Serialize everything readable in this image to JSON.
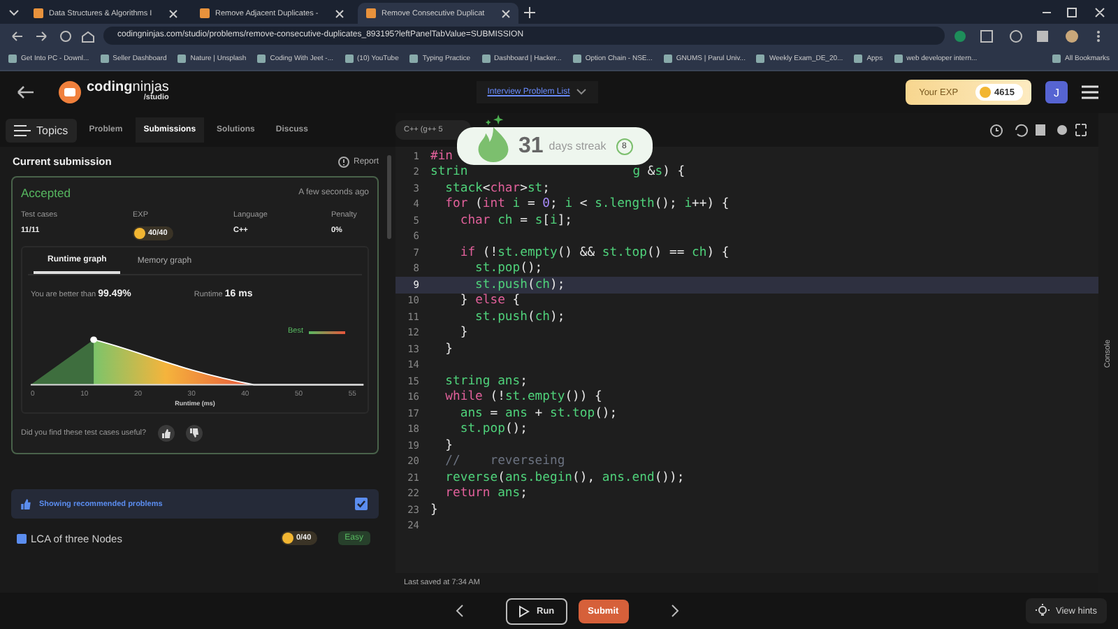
{
  "browser": {
    "tabs": [
      {
        "title": "Data Structures & Algorithms I",
        "selected": false
      },
      {
        "title": "Remove Adjacent Duplicates -",
        "selected": false
      },
      {
        "title": "Remove Consecutive Duplicat",
        "selected": true
      }
    ],
    "url": "codingninjas.com/studio/problems/remove-consecutive-duplicates_893195?leftPanelTabValue=SUBMISSION",
    "bookmarks": [
      "Get Into PC - Downl...",
      "Seller Dashboard",
      "Nature | Unsplash",
      "Coding With Jeet -...",
      "(10) YouTube",
      "Typing Practice",
      "Dashboard | Hacker...",
      "Option Chain - NSE...",
      "GNUMS | Parul Univ...",
      "Weekly Exam_DE_20...",
      "Apps",
      "web developer intern..."
    ],
    "all_bookmarks": "All Bookmarks"
  },
  "header": {
    "logo_word_1": "coding",
    "logo_word_2": "ninjas",
    "logo_sub": "/studio",
    "center_link": "Interview Problem List",
    "exp_label": "Your EXP",
    "exp_value": "4615",
    "avatar": "J"
  },
  "left": {
    "topics": "Topics",
    "tabs": [
      {
        "label": "Problem",
        "selected": false
      },
      {
        "label": "Submissions",
        "selected": true
      },
      {
        "label": "Solutions",
        "selected": false
      },
      {
        "label": "Discuss",
        "selected": false
      }
    ],
    "title": "Current submission",
    "report": "Report",
    "status": "Accepted",
    "time": "A few seconds ago",
    "stats": [
      {
        "label": "Test cases",
        "value": "11/11",
        "kind": "text"
      },
      {
        "label": "EXP",
        "value": "40/40",
        "kind": "coin"
      },
      {
        "label": "Language",
        "value": "C++",
        "kind": "text"
      },
      {
        "label": "Penalty",
        "value": "0%",
        "kind": "text"
      }
    ],
    "graph_tabs": [
      {
        "label": "Runtime graph",
        "selected": true
      },
      {
        "label": "Memory graph",
        "selected": false
      }
    ],
    "better_label": "You are better than",
    "better_value": "99.49%",
    "runtime_label": "Runtime",
    "runtime_value": "16 ms",
    "legend": "Best",
    "x_ticks": [
      "0",
      "10",
      "20",
      "30",
      "40",
      "50",
      "55"
    ],
    "x_label": "Runtime (ms)",
    "feedback": "Did you find these test cases useful?",
    "recommended": {
      "label": "Showing recommended problems",
      "checked": true
    },
    "problems": [
      {
        "title": "LCA of three Nodes",
        "exp": "0/40",
        "difficulty": "Easy"
      }
    ]
  },
  "editor": {
    "language": "C++ (g++ 5",
    "streak": {
      "count": "31",
      "label": "days streak",
      "badge": "8"
    },
    "lines": [
      {
        "n": "1",
        "current": false,
        "tokens": [
          {
            "t": "#in",
            "kind": "keyword"
          }
        ]
      },
      {
        "n": "2",
        "current": false,
        "tokens": [
          {
            "t": "strin",
            "kind": "name"
          }
        ],
        "tokens_after_popup": [
          {
            "t": "g",
            "kind": "name"
          },
          {
            "t": " &",
            "kind": "punct"
          },
          {
            "t": "s",
            "kind": "name"
          },
          {
            "t": ") {",
            "kind": "punct"
          }
        ]
      },
      {
        "n": "3",
        "current": false,
        "tokens": [
          {
            "t": "  stack",
            "kind": "name"
          },
          {
            "t": "<",
            "kind": "punct"
          },
          {
            "t": "char",
            "kind": "keyword"
          },
          {
            "t": ">",
            "kind": "punct"
          },
          {
            "t": "st",
            "kind": "name"
          },
          {
            "t": ";",
            "kind": "punct"
          }
        ]
      },
      {
        "n": "4",
        "current": false,
        "tokens": [
          {
            "t": "  for",
            "kind": "keyword"
          },
          {
            "t": " (",
            "kind": "punct"
          },
          {
            "t": "int",
            "kind": "keyword"
          },
          {
            "t": " i",
            "kind": "name"
          },
          {
            "t": " = ",
            "kind": "punct"
          },
          {
            "t": "0",
            "kind": "number"
          },
          {
            "t": "; ",
            "kind": "punct"
          },
          {
            "t": "i",
            "kind": "name"
          },
          {
            "t": " < ",
            "kind": "punct"
          },
          {
            "t": "s.length",
            "kind": "name"
          },
          {
            "t": "(); ",
            "kind": "punct"
          },
          {
            "t": "i",
            "kind": "name"
          },
          {
            "t": "++) {",
            "kind": "punct"
          }
        ]
      },
      {
        "n": "5",
        "current": false,
        "tokens": [
          {
            "t": "    char",
            "kind": "keyword"
          },
          {
            "t": " ch",
            "kind": "name"
          },
          {
            "t": " = ",
            "kind": "punct"
          },
          {
            "t": "s",
            "kind": "name"
          },
          {
            "t": "[",
            "kind": "punct"
          },
          {
            "t": "i",
            "kind": "name"
          },
          {
            "t": "];",
            "kind": "punct"
          }
        ]
      },
      {
        "n": "6",
        "current": false
      },
      {
        "n": "7",
        "current": false,
        "tokens": [
          {
            "t": "    if",
            "kind": "keyword"
          },
          {
            "t": " (!",
            "kind": "punct"
          },
          {
            "t": "st.empty",
            "kind": "name"
          },
          {
            "t": "() && ",
            "kind": "punct"
          },
          {
            "t": "st.top",
            "kind": "name"
          },
          {
            "t": "() == ",
            "kind": "punct"
          },
          {
            "t": "ch",
            "kind": "name"
          },
          {
            "t": ") {",
            "kind": "punct"
          }
        ]
      },
      {
        "n": "8",
        "current": false,
        "tokens": [
          {
            "t": "      st.pop",
            "kind": "name"
          },
          {
            "t": "();",
            "kind": "punct"
          }
        ]
      },
      {
        "n": "9",
        "current": true,
        "tokens": [
          {
            "t": "      st.push",
            "kind": "name"
          },
          {
            "t": "(",
            "kind": "punct"
          },
          {
            "t": "ch",
            "kind": "name"
          },
          {
            "t": ");",
            "kind": "punct"
          }
        ]
      },
      {
        "n": "10",
        "current": false,
        "tokens": [
          {
            "t": "    } ",
            "kind": "punct"
          },
          {
            "t": "else",
            "kind": "keyword"
          },
          {
            "t": " {",
            "kind": "punct"
          }
        ]
      },
      {
        "n": "11",
        "current": false,
        "tokens": [
          {
            "t": "      st.push",
            "kind": "name"
          },
          {
            "t": "(",
            "kind": "punct"
          },
          {
            "t": "ch",
            "kind": "name"
          },
          {
            "t": ");",
            "kind": "punct"
          }
        ]
      },
      {
        "n": "12",
        "current": false,
        "tokens": [
          {
            "t": "    }",
            "kind": "punct"
          }
        ]
      },
      {
        "n": "13",
        "current": false,
        "tokens": [
          {
            "t": "  }",
            "kind": "punct"
          }
        ]
      },
      {
        "n": "14",
        "current": false
      },
      {
        "n": "15",
        "current": false,
        "tokens": [
          {
            "t": "  string ans",
            "kind": "name"
          },
          {
            "t": ";",
            "kind": "punct"
          }
        ]
      },
      {
        "n": "16",
        "current": false,
        "tokens": [
          {
            "t": "  while",
            "kind": "keyword"
          },
          {
            "t": " (!",
            "kind": "punct"
          },
          {
            "t": "st.empty",
            "kind": "name"
          },
          {
            "t": "()) {",
            "kind": "punct"
          }
        ]
      },
      {
        "n": "17",
        "current": false,
        "tokens": [
          {
            "t": "    ans",
            "kind": "name"
          },
          {
            "t": " = ",
            "kind": "punct"
          },
          {
            "t": "ans",
            "kind": "name"
          },
          {
            "t": " + ",
            "kind": "punct"
          },
          {
            "t": "st.top",
            "kind": "name"
          },
          {
            "t": "();",
            "kind": "punct"
          }
        ]
      },
      {
        "n": "18",
        "current": false,
        "tokens": [
          {
            "t": "    st.pop",
            "kind": "name"
          },
          {
            "t": "();",
            "kind": "punct"
          }
        ]
      },
      {
        "n": "19",
        "current": false,
        "tokens": [
          {
            "t": "  }",
            "kind": "punct"
          }
        ]
      },
      {
        "n": "20",
        "current": false,
        "tokens": [
          {
            "t": "  //    reverseing",
            "kind": "comment"
          }
        ]
      },
      {
        "n": "21",
        "current": false,
        "tokens": [
          {
            "t": "  reverse",
            "kind": "name"
          },
          {
            "t": "(",
            "kind": "punct"
          },
          {
            "t": "ans.begin",
            "kind": "name"
          },
          {
            "t": "(), ",
            "kind": "punct"
          },
          {
            "t": "ans.end",
            "kind": "name"
          },
          {
            "t": "());",
            "kind": "punct"
          }
        ]
      },
      {
        "n": "22",
        "current": false,
        "tokens": [
          {
            "t": "  return",
            "kind": "keyword"
          },
          {
            "t": " ans",
            "kind": "name"
          },
          {
            "t": ";",
            "kind": "punct"
          }
        ]
      },
      {
        "n": "23",
        "current": false,
        "tokens": [
          {
            "t": "}",
            "kind": "punct"
          }
        ]
      },
      {
        "n": "24",
        "current": false
      }
    ],
    "last_saved": "Last saved at 7:34 AM",
    "console": "Console"
  },
  "footer": {
    "run": "Run",
    "submit": "Submit",
    "hints": "View hints"
  }
}
